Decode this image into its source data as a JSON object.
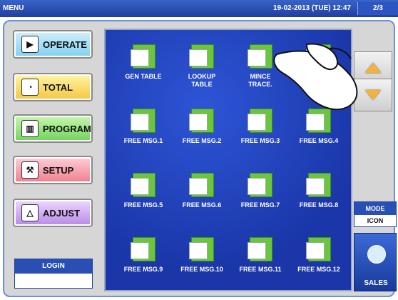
{
  "titlebar": {
    "title": "MENU",
    "datetime": "19-02-2013 (TUE) 12:47",
    "page": "2/3"
  },
  "left_menu": {
    "operate": "OPERATE",
    "total": "TOTAL",
    "program": "PROGRAM",
    "setup": "SETUP",
    "adjust": "ADJUST"
  },
  "login": {
    "label": "LOGIN"
  },
  "tiles": [
    [
      "GEN TABLE",
      "LOOKUP\nTABLE",
      "MINCE\nTRACE.",
      ""
    ],
    [
      "FREE MSG.1",
      "FREE MSG.2",
      "FREE MSG.3",
      "FREE MSG.4"
    ],
    [
      "FREE MSG.5",
      "FREE MSG.6",
      "FREE MSG.7",
      "FREE MSG.8"
    ],
    [
      "FREE MSG.9",
      "FREE MSG.10",
      "FREE MSG.11",
      "FREE MSG.12"
    ]
  ],
  "mode": {
    "label": "MODE",
    "value": "ICON"
  },
  "sales": {
    "label": "SALES"
  },
  "icons": {
    "operate": "play-icon",
    "total": "clock-icon",
    "program": "book-icon",
    "setup": "wrench-icon",
    "adjust": "scale-icon",
    "tile_doc": "document-icon",
    "nav_up": "triangle-up-icon",
    "nav_down": "triangle-down-icon",
    "sales": "play-icon",
    "hand": "pointing-hand-icon"
  },
  "colors": {
    "title_bg": "#2d55c2",
    "grid_bg": "#1a36a8",
    "arrow": "#f3b23a",
    "doc_green": "#6cc63c"
  }
}
